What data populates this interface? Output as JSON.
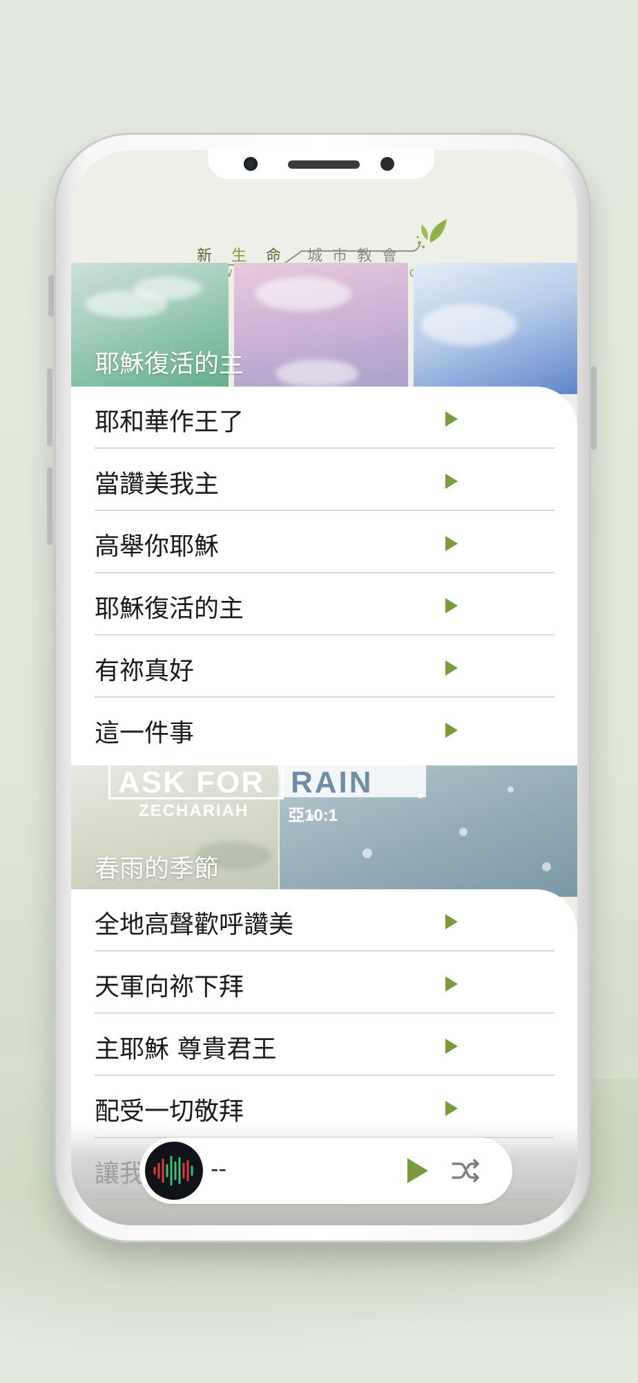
{
  "header": {
    "logo_zh_left": [
      "新",
      "生",
      "命"
    ],
    "logo_zh_right": [
      "城",
      "市",
      "教",
      "會"
    ],
    "logo_en": "NEW LIFE CITY CHURCH"
  },
  "sections": [
    {
      "title": "耶穌復活的主",
      "songs": [
        "耶和華作王了",
        "當讚美我主",
        "高舉你耶穌",
        "耶穌復活的主",
        "有祢真好",
        "這一件事"
      ]
    },
    {
      "title": "春雨的季節",
      "banner_text": {
        "ask": "ASK FOR",
        "rain": "RAIN",
        "book": "ZECHARIAH",
        "verse": "亞10:1"
      },
      "songs": [
        "全地高聲歡呼讚美",
        "天軍向祢下拜",
        "主耶穌 尊貴君王",
        "配受一切敬拜",
        "讓我"
      ]
    }
  ],
  "player": {
    "now_playing": "--",
    "avatar_icon": "waveform-logo-icon",
    "play_icon": "play-icon",
    "shuffle_icon": "shuffle-icon"
  },
  "colors": {
    "accent": "#7a9a3c",
    "logo_text": "#556a33"
  }
}
